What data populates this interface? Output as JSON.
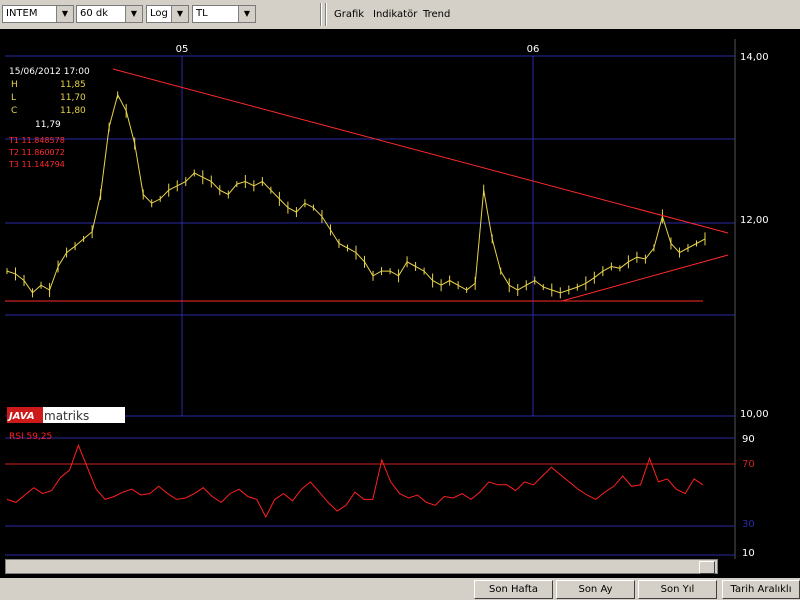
{
  "toolbar": {
    "symbol": "INTEM",
    "interval": "60 dk",
    "scale": "Log",
    "currency": "TL",
    "menus": [
      "Grafik",
      "Indikatör",
      "Trend"
    ]
  },
  "chart": {
    "x_labels": [
      "05",
      "06"
    ],
    "y_labels": [
      "14,00",
      "12,00",
      "10,00"
    ],
    "info": {
      "date": "15/06/2012 17:00",
      "h_label": "H",
      "h": "11,85",
      "l_label": "L",
      "l": "11,70",
      "c_label": "C",
      "c": "11,80",
      "last": "11,79"
    },
    "trend_values": [
      "T1 11.848578",
      "T2 11.860072",
      "T3 11.144794"
    ],
    "logo_left": "JAVA",
    "logo_right": "matriks"
  },
  "rsi": {
    "label": "RSI 59,25",
    "y_labels": [
      "90",
      "70",
      "30",
      "10"
    ]
  },
  "buttons": [
    "Son Hafta",
    "Son Ay",
    "Son Yıl",
    "Tarih Aralıklı"
  ],
  "colors": {
    "price": "#e8d44a",
    "trend": "#ff2a2a",
    "rsi": "#ff2020",
    "grid": "#2a2aa8"
  },
  "chart_data": {
    "type": "line",
    "series": [
      {
        "values": [
          11.45,
          11.42,
          11.35,
          11.22,
          11.3,
          11.25,
          11.5,
          11.65,
          11.72,
          11.8,
          11.88,
          12.3,
          13.1,
          13.5,
          13.3,
          12.9,
          12.3,
          12.2,
          12.25,
          12.35,
          12.4,
          12.45,
          12.55,
          12.5,
          12.45,
          12.35,
          12.3,
          12.42,
          12.45,
          12.4,
          12.45,
          12.35,
          12.25,
          12.15,
          12.1,
          12.2,
          12.15,
          12.05,
          11.9,
          11.75,
          11.7,
          11.65,
          11.55,
          11.4,
          11.45,
          11.45,
          11.4,
          11.55,
          11.5,
          11.45,
          11.35,
          11.3,
          11.35,
          11.3,
          11.25,
          11.32,
          12.35,
          11.8,
          11.45,
          11.3,
          11.25,
          11.3,
          11.35,
          11.28,
          11.25,
          11.22,
          11.25,
          11.28,
          11.32,
          11.38,
          11.45,
          11.5,
          11.48,
          11.55,
          11.6,
          11.58,
          11.7,
          12.05,
          11.75,
          11.65,
          11.7,
          11.75,
          11.8
        ]
      },
      {
        "values": [
          48,
          46,
          51,
          56,
          52,
          54,
          63,
          68,
          85,
          70,
          55,
          48,
          50,
          53,
          55,
          51,
          52,
          57,
          52,
          48,
          49,
          52,
          56,
          50,
          46,
          52,
          55,
          50,
          48,
          36,
          48,
          52,
          47,
          55,
          60,
          53,
          46,
          40,
          44,
          53,
          48,
          48,
          75,
          60,
          52,
          49,
          51,
          46,
          44,
          50,
          49,
          52,
          48,
          53,
          60,
          58,
          58,
          54,
          60,
          58,
          64,
          70,
          65,
          60,
          55,
          51,
          48,
          53,
          57,
          64,
          57,
          58,
          76,
          60,
          62,
          55,
          52,
          62,
          58
        ]
      }
    ],
    "ylim": [
      10,
      14
    ]
  }
}
